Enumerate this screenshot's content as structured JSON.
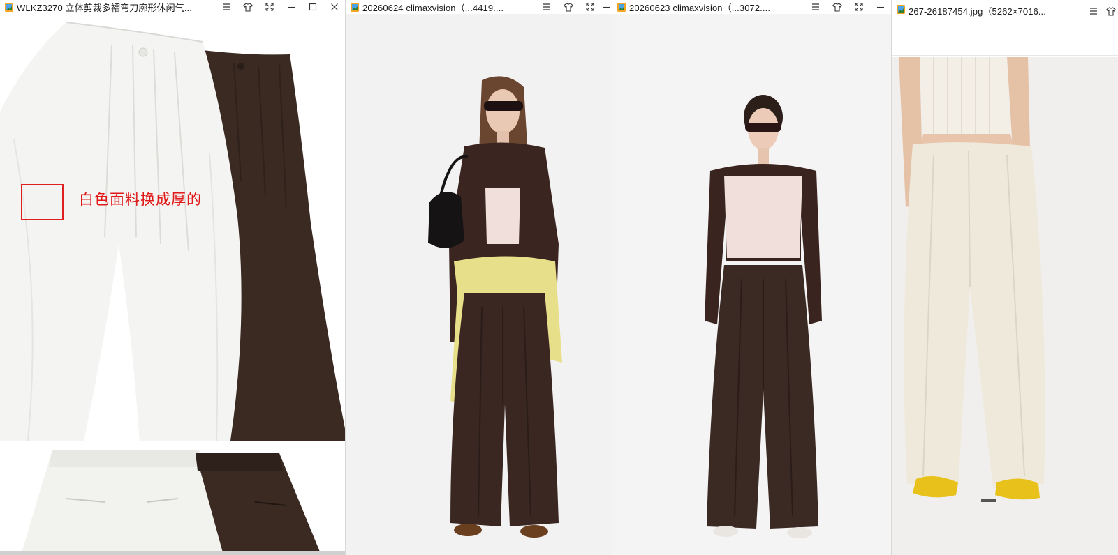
{
  "windows": [
    {
      "title": "WLKZ3270 立体剪裁多褶弯刀廓形休闲气...",
      "annotation": "白色面料换成厚的",
      "controls": [
        "menu-icon",
        "shirt-icon",
        "fit-icon",
        "minimize-icon",
        "maximize-icon",
        "close-icon"
      ]
    },
    {
      "title": "20260624 climaxvision（...4419....",
      "controls": [
        "menu-icon",
        "shirt-icon",
        "fit-icon",
        "minimize-icon"
      ]
    },
    {
      "title": "20260623 climaxvision（...3072....",
      "controls": [
        "menu-icon",
        "shirt-icon",
        "fit-icon",
        "minimize-icon"
      ]
    },
    {
      "title": "267-26187454.jpg（5262×7016...",
      "controls": [
        "menu-icon",
        "shirt-icon"
      ]
    }
  ],
  "colors": {
    "pants_brown": "#3a2a22",
    "pants_white": "#f4f4f2",
    "pants_cream": "#efe9dc",
    "cardigan_brown": "#3b2520",
    "scarf_yellow": "#e8df8a",
    "sneaker_yellow": "#e8c21a",
    "annotation_red": "#e01818",
    "backdrop": "#f3f2f2"
  }
}
